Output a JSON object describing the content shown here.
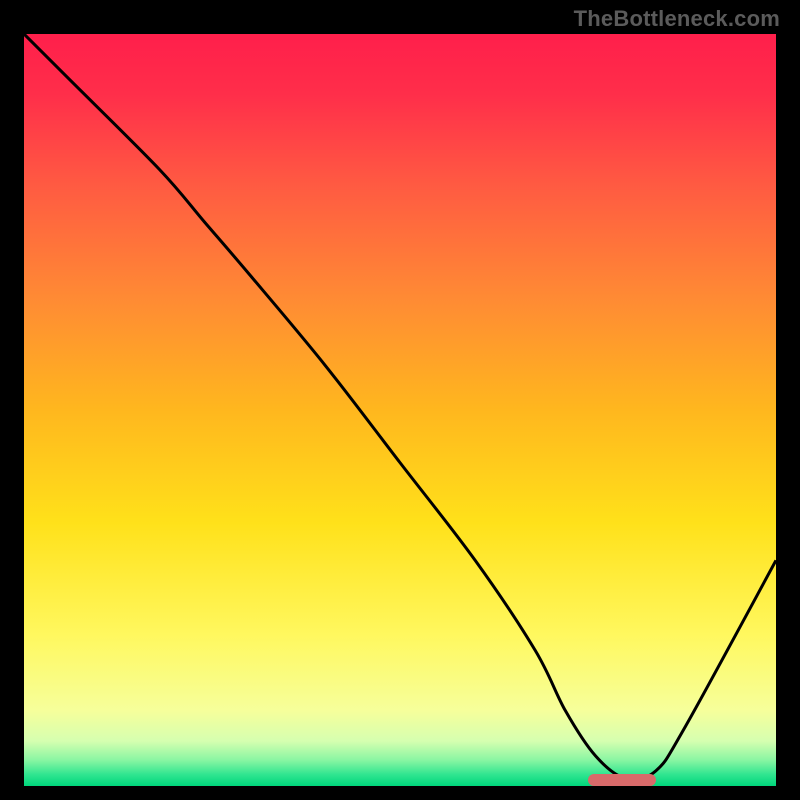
{
  "watermark": "TheBottleneck.com",
  "chart_data": {
    "type": "line",
    "title": "",
    "xlabel": "",
    "ylabel": "",
    "xlim": [
      0,
      100
    ],
    "ylim": [
      0,
      100
    ],
    "grid": false,
    "series": [
      {
        "name": "bottleneck-curve",
        "x": [
          0,
          6,
          18,
          24,
          30,
          40,
          50,
          60,
          68,
          72,
          76,
          80,
          84,
          88,
          100
        ],
        "y": [
          100,
          94,
          82,
          75,
          68,
          56,
          43,
          30,
          18,
          10,
          4,
          1,
          2,
          8,
          30
        ]
      }
    ],
    "marker": {
      "x_start": 75,
      "x_end": 84,
      "y": 0.5,
      "color": "#d86a6a"
    },
    "gradient_stops": [
      {
        "pos": 0.0,
        "color": "#ff1f4b"
      },
      {
        "pos": 0.08,
        "color": "#ff2e4a"
      },
      {
        "pos": 0.2,
        "color": "#ff5a42"
      },
      {
        "pos": 0.35,
        "color": "#ff8a34"
      },
      {
        "pos": 0.5,
        "color": "#ffb71e"
      },
      {
        "pos": 0.65,
        "color": "#ffe11a"
      },
      {
        "pos": 0.8,
        "color": "#fff85f"
      },
      {
        "pos": 0.9,
        "color": "#f6ff9b"
      },
      {
        "pos": 0.94,
        "color": "#d6ffb0"
      },
      {
        "pos": 0.965,
        "color": "#8bf6a3"
      },
      {
        "pos": 0.985,
        "color": "#2fe590"
      },
      {
        "pos": 1.0,
        "color": "#00d67b"
      }
    ]
  }
}
